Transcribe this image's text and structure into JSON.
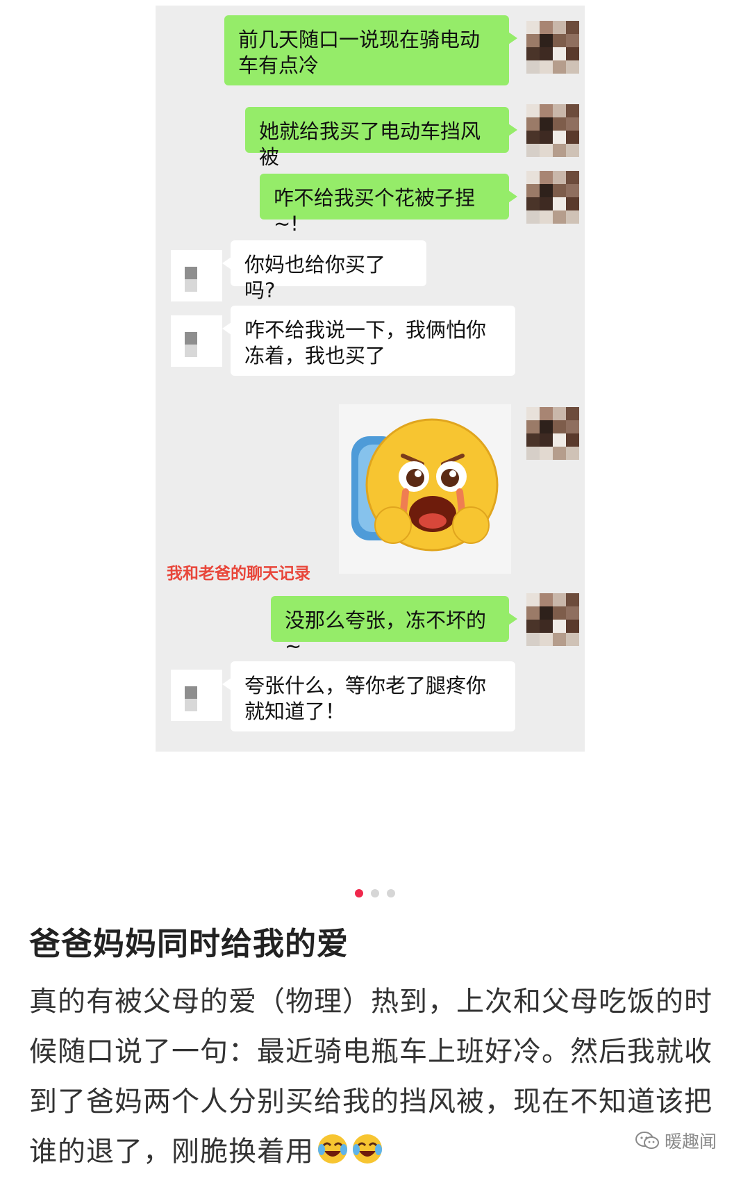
{
  "chat": {
    "messages": [
      {
        "side": "me",
        "text": "前几天随口一说现在骑电动车有点冷"
      },
      {
        "side": "me",
        "text": "她就给我买了电动车挡风被"
      },
      {
        "side": "me",
        "text": "咋不给我买个花被子捏~!"
      },
      {
        "side": "other",
        "text": "你妈也给你买了吗?"
      },
      {
        "side": "other",
        "text": "咋不给我说一下，我俩怕你冻着，我也买了"
      },
      {
        "side": "me",
        "type": "sticker",
        "icon": "crying-emoji-sticker"
      },
      {
        "side": "me",
        "text": "没那么夸张，冻不坏的~"
      },
      {
        "side": "other",
        "text": "夸张什么，等你老了腿疼你就知道了！"
      }
    ],
    "overlay_caption": "我和老爸的聊天记录"
  },
  "carousel": {
    "count": 3,
    "active_index": 0
  },
  "post": {
    "title": "爸爸妈妈同时给我的爱",
    "body": "真的有被父母的爱（物理）热到，上次和父母吃饭的时候随口说了一句：最近骑电瓶车上班好冷。然后我就收到了爸妈两个人分别买给我的挡风被，现在不知道该把谁的退了，刚脆换着用",
    "trailing_emoji": [
      "laughing-crying-emoji",
      "laughing-crying-emoji"
    ]
  },
  "watermark": {
    "text": "暖趣闻",
    "icon": "wechat-icon"
  },
  "colors": {
    "my_bubble": "#95ec69",
    "other_bubble": "#ffffff",
    "chat_bg": "#ededed",
    "caption_red": "#e8463a",
    "dot_active": "#f0284c"
  }
}
